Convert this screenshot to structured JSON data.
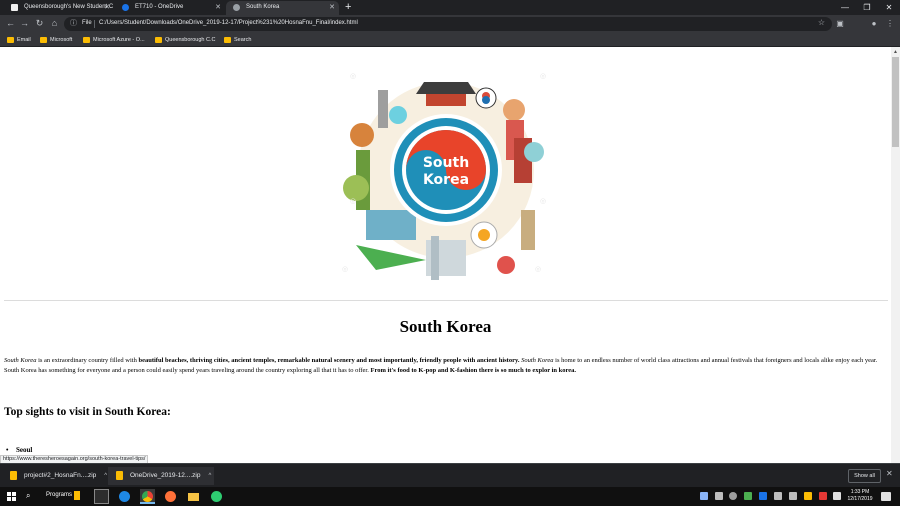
{
  "browser": {
    "tabs": [
      {
        "title": "Queensborough's New Student C",
        "active": false,
        "favicon_color": "#f0f0f0"
      },
      {
        "title": "ET710 - OneDrive",
        "active": false,
        "favicon_color": "#1a73e8"
      },
      {
        "title": "South Korea",
        "active": true,
        "favicon_color": "#9aa0a6"
      }
    ],
    "new_tab": "+",
    "url_scheme": "File",
    "url": "C:/Users/Student/Downloads/OneDrive_2019-12-17/Project%231%20HosnaFnu_Final/index.html",
    "bookmarks": [
      "Email",
      "Microsoft",
      "Microsoft Azure - O...",
      "Queensborough C.C",
      "Search"
    ]
  },
  "page": {
    "hero_logo_line1": "South",
    "hero_logo_line2": "Korea",
    "heading": "South Korea",
    "intro": {
      "p1_italic": "South Korea",
      "p2": " is an extraordinary country filled with ",
      "p3_bold": "beautiful beaches, thriving cities, ancient temples, remarkable natural scenery and most importantly, friendly people with ancient history.",
      "p4": " ",
      "p5_italic": "South Korea",
      "p6": " is home to an endless number of world class attractions and annual festivals that foreigners and locals alike enjoy each year. South Korea has something for everyone and a person could easily spend years traveling around the country exploring all that it has to offer. ",
      "p7_bold": "From it's food to K-pop and K-fashion there is so much to explor in korea."
    },
    "subheading": "Top sights to visit in South Korea:",
    "list": [
      "Seoul"
    ],
    "status_url": "https://www.theresheroesagain.org/south-korea-travel-tips/"
  },
  "downloads": {
    "items": [
      "project#2_HosnaFn....zip",
      "OneDrive_2019-12....zip"
    ],
    "show_all": "Show all"
  },
  "taskbar": {
    "search_label": "Programs",
    "time": "1:33 PM",
    "date": "12/17/2019"
  },
  "colors": {
    "accent_red": "#e8442a",
    "accent_teal": "#1f8fb8",
    "folder": "#fbbc04"
  }
}
